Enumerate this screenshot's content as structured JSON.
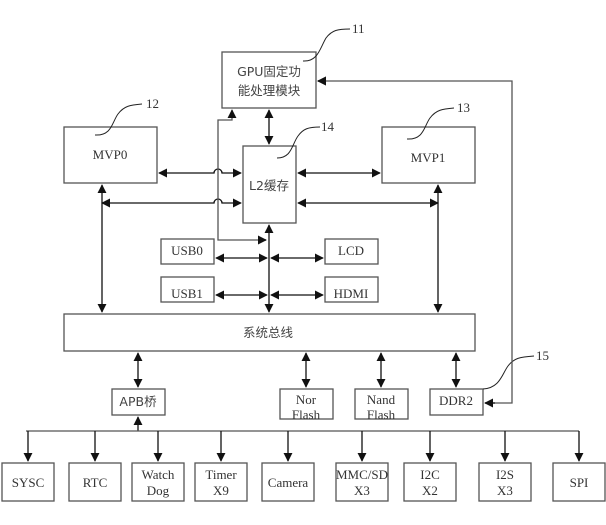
{
  "diagram": {
    "blocks": {
      "gpu": {
        "line1": "GPU固定功",
        "line2": "能处理模块",
        "ref": "11"
      },
      "mvp0": {
        "label": "MVP0",
        "ref": "12"
      },
      "mvp1": {
        "label": "MVP1",
        "ref": "13"
      },
      "l2": {
        "label": "L2缓存",
        "ref": "14"
      },
      "usb0": {
        "label": "USB0"
      },
      "usb1": {
        "label": "USB1"
      },
      "lcd": {
        "label": "LCD"
      },
      "hdmi": {
        "label": "HDMI"
      },
      "bus": {
        "label": "系统总线"
      },
      "apb": {
        "label": "APB桥"
      },
      "nor": {
        "line1": "Nor",
        "line2": "Flash"
      },
      "nand": {
        "line1": "Nand",
        "line2": "Flash"
      },
      "ddr2": {
        "label": "DDR2",
        "ref": "15"
      }
    },
    "peripherals": [
      {
        "line1": "SYSC",
        "line2": ""
      },
      {
        "line1": "RTC",
        "line2": ""
      },
      {
        "line1": "Watch",
        "line2": "Dog"
      },
      {
        "line1": "Timer",
        "line2": "X9"
      },
      {
        "line1": "Camera",
        "line2": ""
      },
      {
        "line1": "MMC/SD",
        "line2": "X3"
      },
      {
        "line1": "I2C",
        "line2": "X2"
      },
      {
        "line1": "I2S",
        "line2": "X3"
      },
      {
        "line1": "SPI",
        "line2": ""
      }
    ]
  }
}
